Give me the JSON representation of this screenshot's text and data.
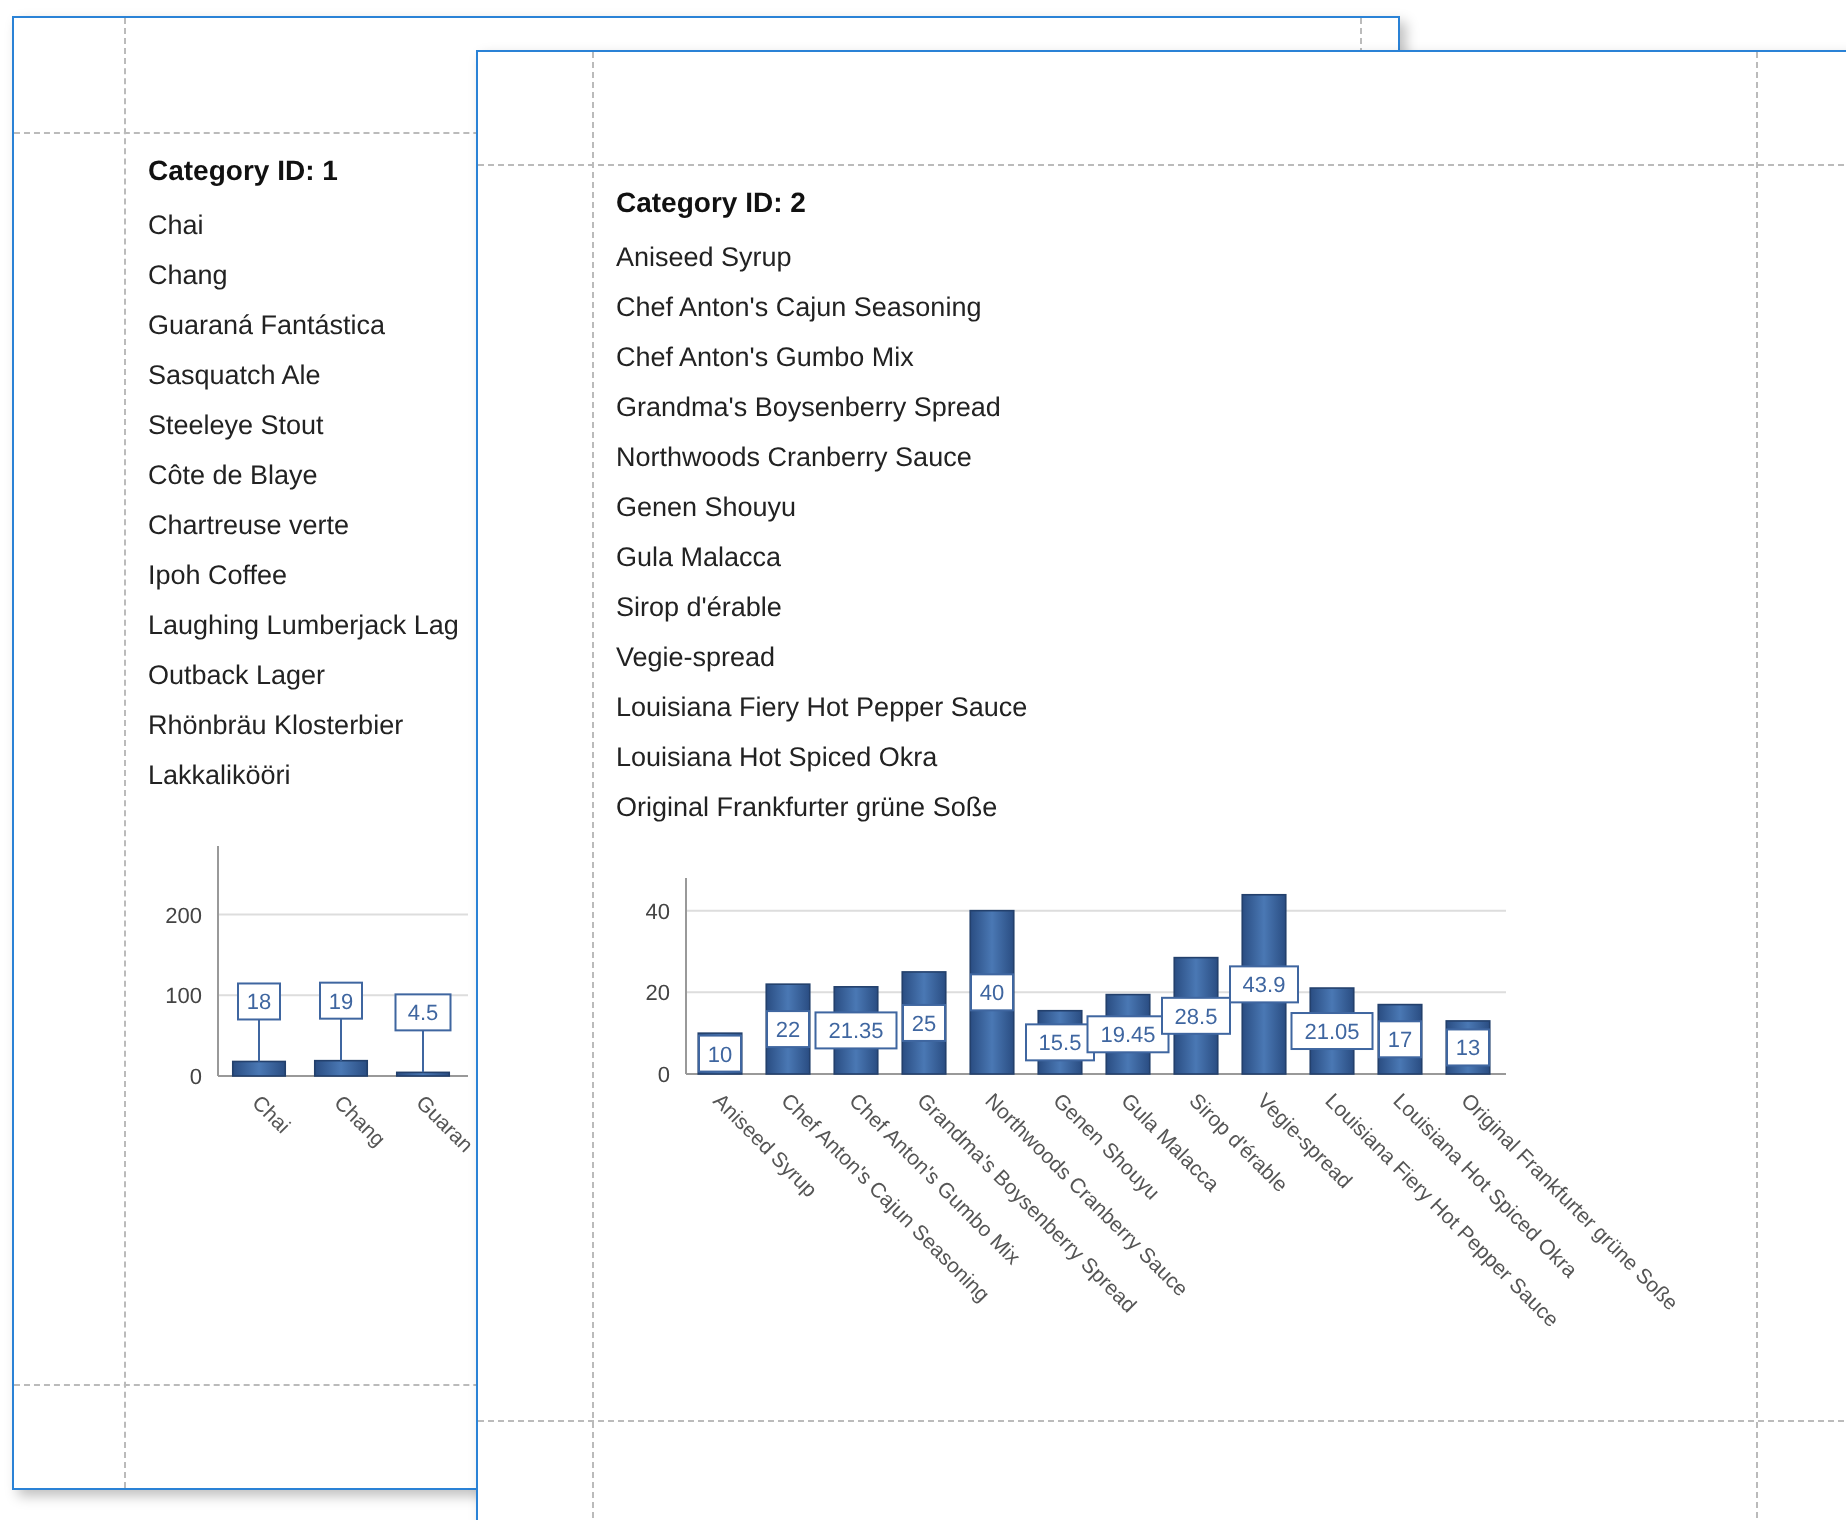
{
  "pages": [
    {
      "title": "Category ID: 1",
      "products": [
        "Chai",
        "Chang",
        "Guaraná Fantástica",
        "Sasquatch Ale",
        "Steeleye Stout",
        "Côte de Blaye",
        "Chartreuse verte",
        "Ipoh Coffee",
        "Laughing Lumberjack Lag",
        "Outback Lager",
        "Rhönbräu Klosterbier",
        "Lakkalikööri"
      ],
      "chart_data": {
        "type": "bar",
        "categories": [
          "Chai",
          "Chang",
          "Guaran"
        ],
        "values": [
          18,
          19,
          4.5
        ],
        "ylim": [
          0,
          285
        ],
        "yticks": [
          0,
          100,
          200
        ],
        "data_labels": true
      }
    },
    {
      "title": "Category ID: 2",
      "products": [
        "Aniseed Syrup",
        "Chef Anton's Cajun Seasoning",
        "Chef Anton's Gumbo Mix",
        "Grandma's Boysenberry Spread",
        "Northwoods Cranberry Sauce",
        "Genen Shouyu",
        "Gula Malacca",
        "Sirop d'érable",
        "Vegie-spread",
        "Louisiana Fiery Hot Pepper Sauce",
        "Louisiana Hot Spiced Okra",
        "Original Frankfurter grüne Soße"
      ],
      "chart_data": {
        "type": "bar",
        "categories": [
          "Aniseed Syrup",
          "Chef Anton's Cajun Seasoning",
          "Chef Anton's Gumbo Mix",
          "Grandma's Boysenberry Spread",
          "Northwoods Cranberry Sauce",
          "Genen Shouyu",
          "Gula Malacca",
          "Sirop d'érable",
          "Vegie-spread",
          "Louisiana Fiery Hot Pepper Sauce",
          "Louisiana Hot Spiced Okra",
          "Original Frankfurter grüne Soße"
        ],
        "values": [
          10,
          22,
          21.35,
          25,
          40,
          15.5,
          19.45,
          28.5,
          43.9,
          21.05,
          17,
          13
        ],
        "ylim": [
          0,
          48
        ],
        "yticks": [
          0,
          20,
          40
        ],
        "data_labels": true
      }
    }
  ]
}
